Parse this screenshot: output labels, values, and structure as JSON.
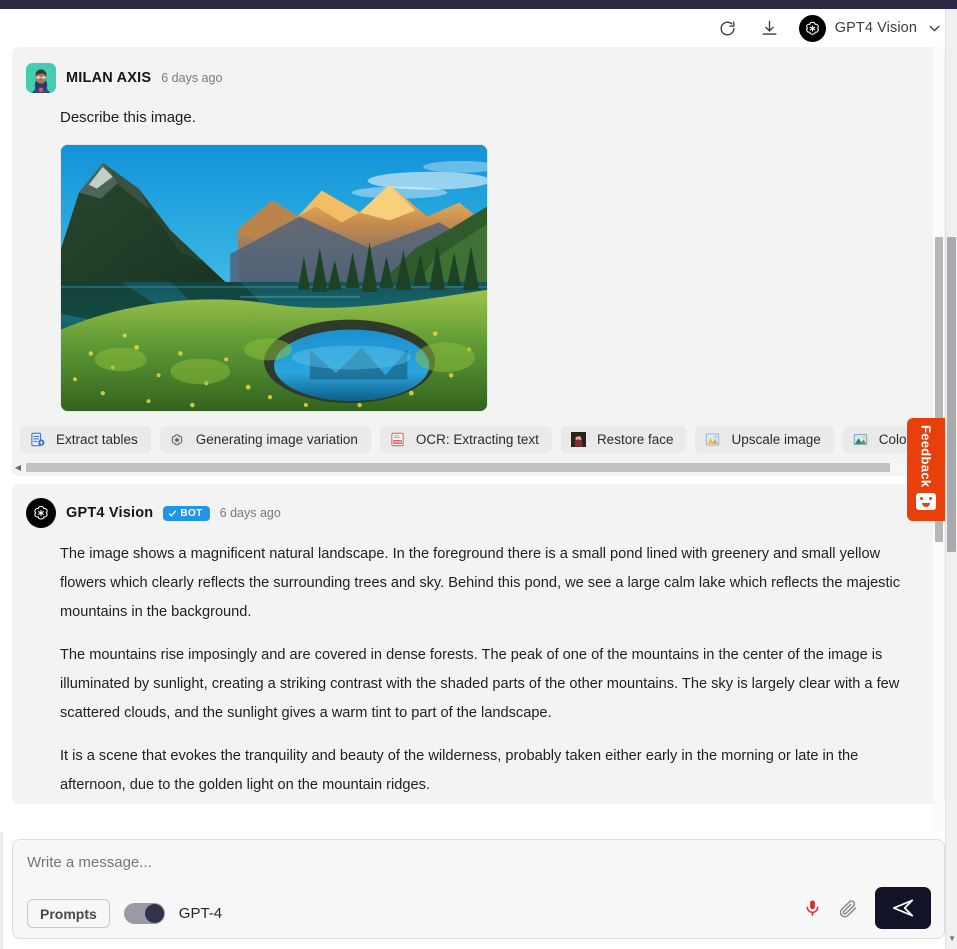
{
  "header": {
    "refresh_icon": "refresh-icon",
    "download_icon": "download-icon",
    "bot_logo_icon": "openai-logo-icon",
    "bot_name": "GPT4 Vision",
    "chevron_icon": "chevron-down-icon"
  },
  "messages": [
    {
      "role": "user",
      "sender": "MILAN AXIS",
      "timestamp": "6 days ago",
      "text": "Describe this image.",
      "attachment": "mountain-lake-landscape-photo"
    },
    {
      "role": "bot",
      "sender": "GPT4 Vision",
      "badge": "BOT",
      "timestamp": "6 days ago",
      "paragraphs": [
        "The image shows a magnificent natural landscape. In the foreground there is a small pond lined with greenery and small yellow flowers which clearly reflects the surrounding trees and sky. Behind this pond, we see a large calm lake which reflects the majestic mountains in the background.",
        "The mountains rise imposingly and are covered in dense forests. The peak of one of the mountains in the center of the image is illuminated by sunlight, creating a striking contrast with the shaded parts of the other mountains. The sky is largely clear with a few scattered clouds, and the sunlight gives a warm tint to part of the landscape.",
        "It is a scene that evokes the tranquility and beauty of the wilderness, probably taken either early in the morning or late in the afternoon, due to the golden light on the mountain ridges."
      ]
    }
  ],
  "action_chips": [
    {
      "label": "Extract tables",
      "icon": "extract-tables-icon"
    },
    {
      "label": "Generating image variation",
      "icon": "openai-logo-icon"
    },
    {
      "label": "OCR: Extracting text",
      "icon": "ocr-icon"
    },
    {
      "label": "Restore face",
      "icon": "restore-face-icon"
    },
    {
      "label": "Upscale image",
      "icon": "upscale-image-icon"
    },
    {
      "label": "Colorize",
      "icon": "colorize-icon"
    }
  ],
  "composer": {
    "placeholder": "Write a message...",
    "value": "",
    "prompts_label": "Prompts",
    "model_toggle_label": "GPT-4",
    "model_toggle_on": true,
    "mic_icon": "microphone-icon",
    "attach_icon": "paperclip-icon",
    "send_icon": "send-icon"
  },
  "feedback": {
    "label": "Feedback",
    "face_icon": "smiley-face-icon"
  },
  "colors": {
    "topbar": "#2b2b45",
    "message_bg": "#f3f3f3",
    "bot_badge": "#2196e8",
    "feedback": "#e8400d",
    "send_button": "#121228",
    "mic": "#d32f2f"
  }
}
